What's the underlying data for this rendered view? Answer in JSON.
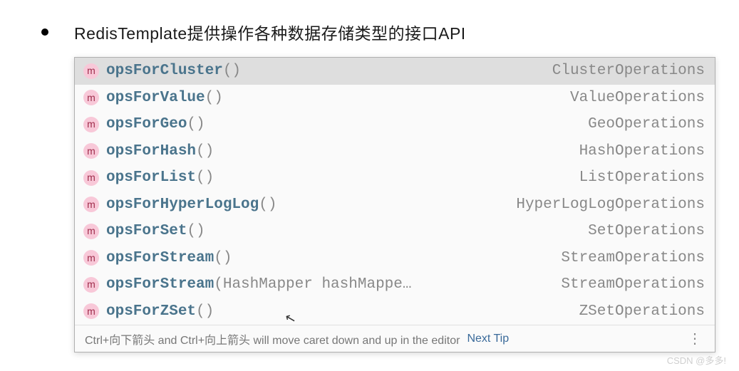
{
  "heading": "RedisTemplate提供操作各种数据存储类型的接口API",
  "icon_letter": "m",
  "items": [
    {
      "name": "opsForCluster",
      "params": "()",
      "return": "ClusterOperations",
      "selected": true
    },
    {
      "name": "opsForValue",
      "params": "()",
      "return": "ValueOperations",
      "selected": false
    },
    {
      "name": "opsForGeo",
      "params": "()",
      "return": "GeoOperations",
      "selected": false
    },
    {
      "name": "opsForHash",
      "params": "()",
      "return": "HashOperations",
      "selected": false
    },
    {
      "name": "opsForList",
      "params": "()",
      "return": "ListOperations",
      "selected": false
    },
    {
      "name": "opsForHyperLogLog",
      "params": "()",
      "return": "HyperLogLogOperations",
      "selected": false
    },
    {
      "name": "opsForSet",
      "params": "()",
      "return": "SetOperations",
      "selected": false
    },
    {
      "name": "opsForStream",
      "params": "()",
      "return": "StreamOperations",
      "selected": false
    },
    {
      "name": "opsForStream",
      "params": "(HashMapper hashMappe…",
      "return": "StreamOperations",
      "selected": false
    },
    {
      "name": "opsForZSet",
      "params": "()",
      "return": "ZSetOperations",
      "selected": false
    }
  ],
  "footer": {
    "hint": "Ctrl+向下箭头 and Ctrl+向上箭头 will move caret down and up in the editor",
    "next_tip": "Next Tip"
  },
  "watermark": "CSDN @多多!"
}
